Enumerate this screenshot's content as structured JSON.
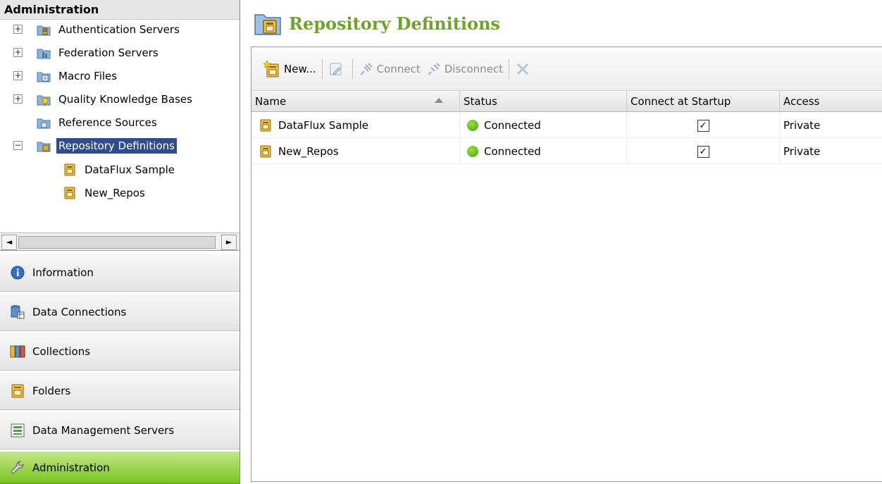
{
  "left_panel": {
    "header": "Administration",
    "tree": [
      {
        "label": "Authentication Servers",
        "expander": "+",
        "icon": "authentication-servers-icon"
      },
      {
        "label": "Federation Servers",
        "expander": "+",
        "icon": "federation-servers-icon"
      },
      {
        "label": "Macro Files",
        "expander": "+",
        "icon": "macro-files-icon"
      },
      {
        "label": "Quality Knowledge Bases",
        "expander": "+",
        "icon": "quality-knowledge-bases-icon"
      },
      {
        "label": "Reference Sources",
        "expander": "",
        "icon": "reference-sources-icon"
      },
      {
        "label": "Repository Definitions",
        "expander": "−",
        "icon": "repository-definitions-icon",
        "selected": true
      },
      {
        "label": "DataFlux Sample",
        "expander": "",
        "icon": "repository-icon"
      },
      {
        "label": "New_Repos",
        "expander": "",
        "icon": "repository-icon"
      }
    ],
    "scroll_left": "◄",
    "scroll_right": "►",
    "nav_buttons": [
      {
        "label": "Information",
        "icon": "info-icon"
      },
      {
        "label": "Data Connections",
        "icon": "data-connections-icon"
      },
      {
        "label": "Collections",
        "icon": "collections-icon"
      },
      {
        "label": "Folders",
        "icon": "folders-icon"
      },
      {
        "label": "Data Management Servers",
        "icon": "data-management-servers-icon"
      },
      {
        "label": "Administration",
        "icon": "wrench-icon",
        "active": true
      }
    ]
  },
  "main": {
    "title": "Repository Definitions",
    "toolbar": {
      "new_label": "New...",
      "connect_label": "Connect",
      "disconnect_label": "Disconnect"
    },
    "columns": [
      "Name",
      "Status",
      "Connect at Startup",
      "Access"
    ],
    "rows": [
      {
        "name": "DataFlux Sample",
        "status": "Connected",
        "connect_at_startup": "☑",
        "access": "Private"
      },
      {
        "name": "New_Repos",
        "status": "Connected",
        "connect_at_startup": "☑",
        "access": "Private"
      }
    ],
    "colors": {
      "title": "#6fa22b",
      "selection": "#2f4d8a",
      "status_connected": "#4fb516",
      "active_nav": "#78c41e"
    }
  }
}
